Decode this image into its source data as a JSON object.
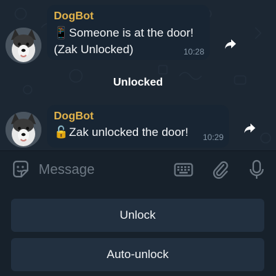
{
  "messages": [
    {
      "sender": "DogBot",
      "line1_emoji": "📱",
      "line1_text": "Someone is at the door!",
      "line2_text": "(Zak Unlocked)",
      "time": "10:28"
    },
    {
      "sender": "DogBot",
      "line1_emoji": "🔓",
      "line1_text": "Zak unlocked the door!",
      "time": "10:29"
    }
  ],
  "service_message": "Unlocked",
  "input": {
    "placeholder": "Message"
  },
  "keyboard_buttons": [
    {
      "label": "Unlock"
    },
    {
      "label": "Auto-unlock"
    }
  ],
  "colors": {
    "sender_name": "#e2b34b",
    "bubble": "#182533",
    "chat_background": "#1c2733",
    "button": "#223040"
  },
  "icons": [
    "dog-avatar-icon",
    "forward-icon",
    "emoji-sticker-icon",
    "keyboard-icon",
    "paperclip-icon",
    "microphone-icon"
  ]
}
